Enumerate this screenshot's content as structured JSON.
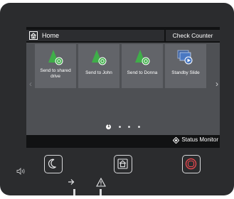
{
  "header": {
    "home_label": "Home",
    "check_counter_label": "Check Counter"
  },
  "tiles": [
    {
      "label": "Send to shared drive",
      "icon": "send-green-icon"
    },
    {
      "label": "Send to John",
      "icon": "send-green-icon"
    },
    {
      "label": "Send to Donna",
      "icon": "send-green-icon"
    },
    {
      "label": "Standby Slide",
      "icon": "slideshow-blue-icon"
    }
  ],
  "pagination": {
    "current": "1",
    "total_pages": 4
  },
  "footer": {
    "status_monitor_label": "Status Monitor"
  },
  "hardware": {
    "buttons": [
      "energy-saver-button",
      "home-button",
      "stop-button"
    ],
    "indicators": [
      "data-led-icon",
      "error-led-icon"
    ]
  },
  "colors": {
    "accent_green": "#3fae49",
    "stop_red": "#e2474d",
    "slide_blue": "#4a78c2"
  }
}
